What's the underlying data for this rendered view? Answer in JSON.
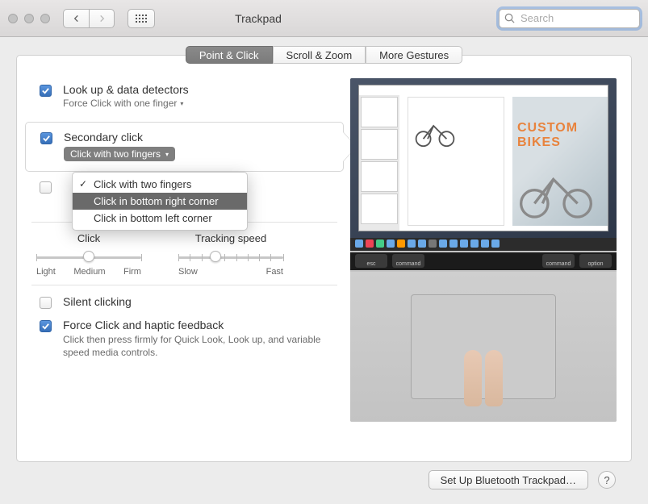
{
  "window": {
    "title": "Trackpad"
  },
  "search": {
    "placeholder": "Search",
    "value": ""
  },
  "tabs": {
    "point_click": "Point & Click",
    "scroll_zoom": "Scroll & Zoom",
    "more_gestures": "More Gestures"
  },
  "options": {
    "lookup": {
      "title": "Look up & data detectors",
      "subtitle": "Force Click with one finger"
    },
    "secondary": {
      "title": "Secondary click",
      "subtitle": "Click with two fingers"
    },
    "dropdown": {
      "opt1": "Click with two fingers",
      "opt2": "Click in bottom right corner",
      "opt3": "Click in bottom left corner"
    },
    "silent": {
      "title": "Silent clicking"
    },
    "force": {
      "title": "Force Click and haptic feedback",
      "desc": "Click then press firmly for Quick Look, Look up, and variable speed media controls."
    }
  },
  "sliders": {
    "click": {
      "title": "Click",
      "labels": {
        "a": "Light",
        "b": "Medium",
        "c": "Firm"
      }
    },
    "tracking": {
      "title": "Tracking speed",
      "labels": {
        "a": "Slow",
        "b": "Fast"
      }
    }
  },
  "footer": {
    "setup_bt": "Set Up Bluetooth Trackpad…",
    "help": "?"
  },
  "preview": {
    "custom_bikes_line1": "CUSTOM",
    "custom_bikes_line2": "BIKES",
    "touchbar": {
      "esc": "esc",
      "command": "command",
      "option": "option"
    }
  }
}
